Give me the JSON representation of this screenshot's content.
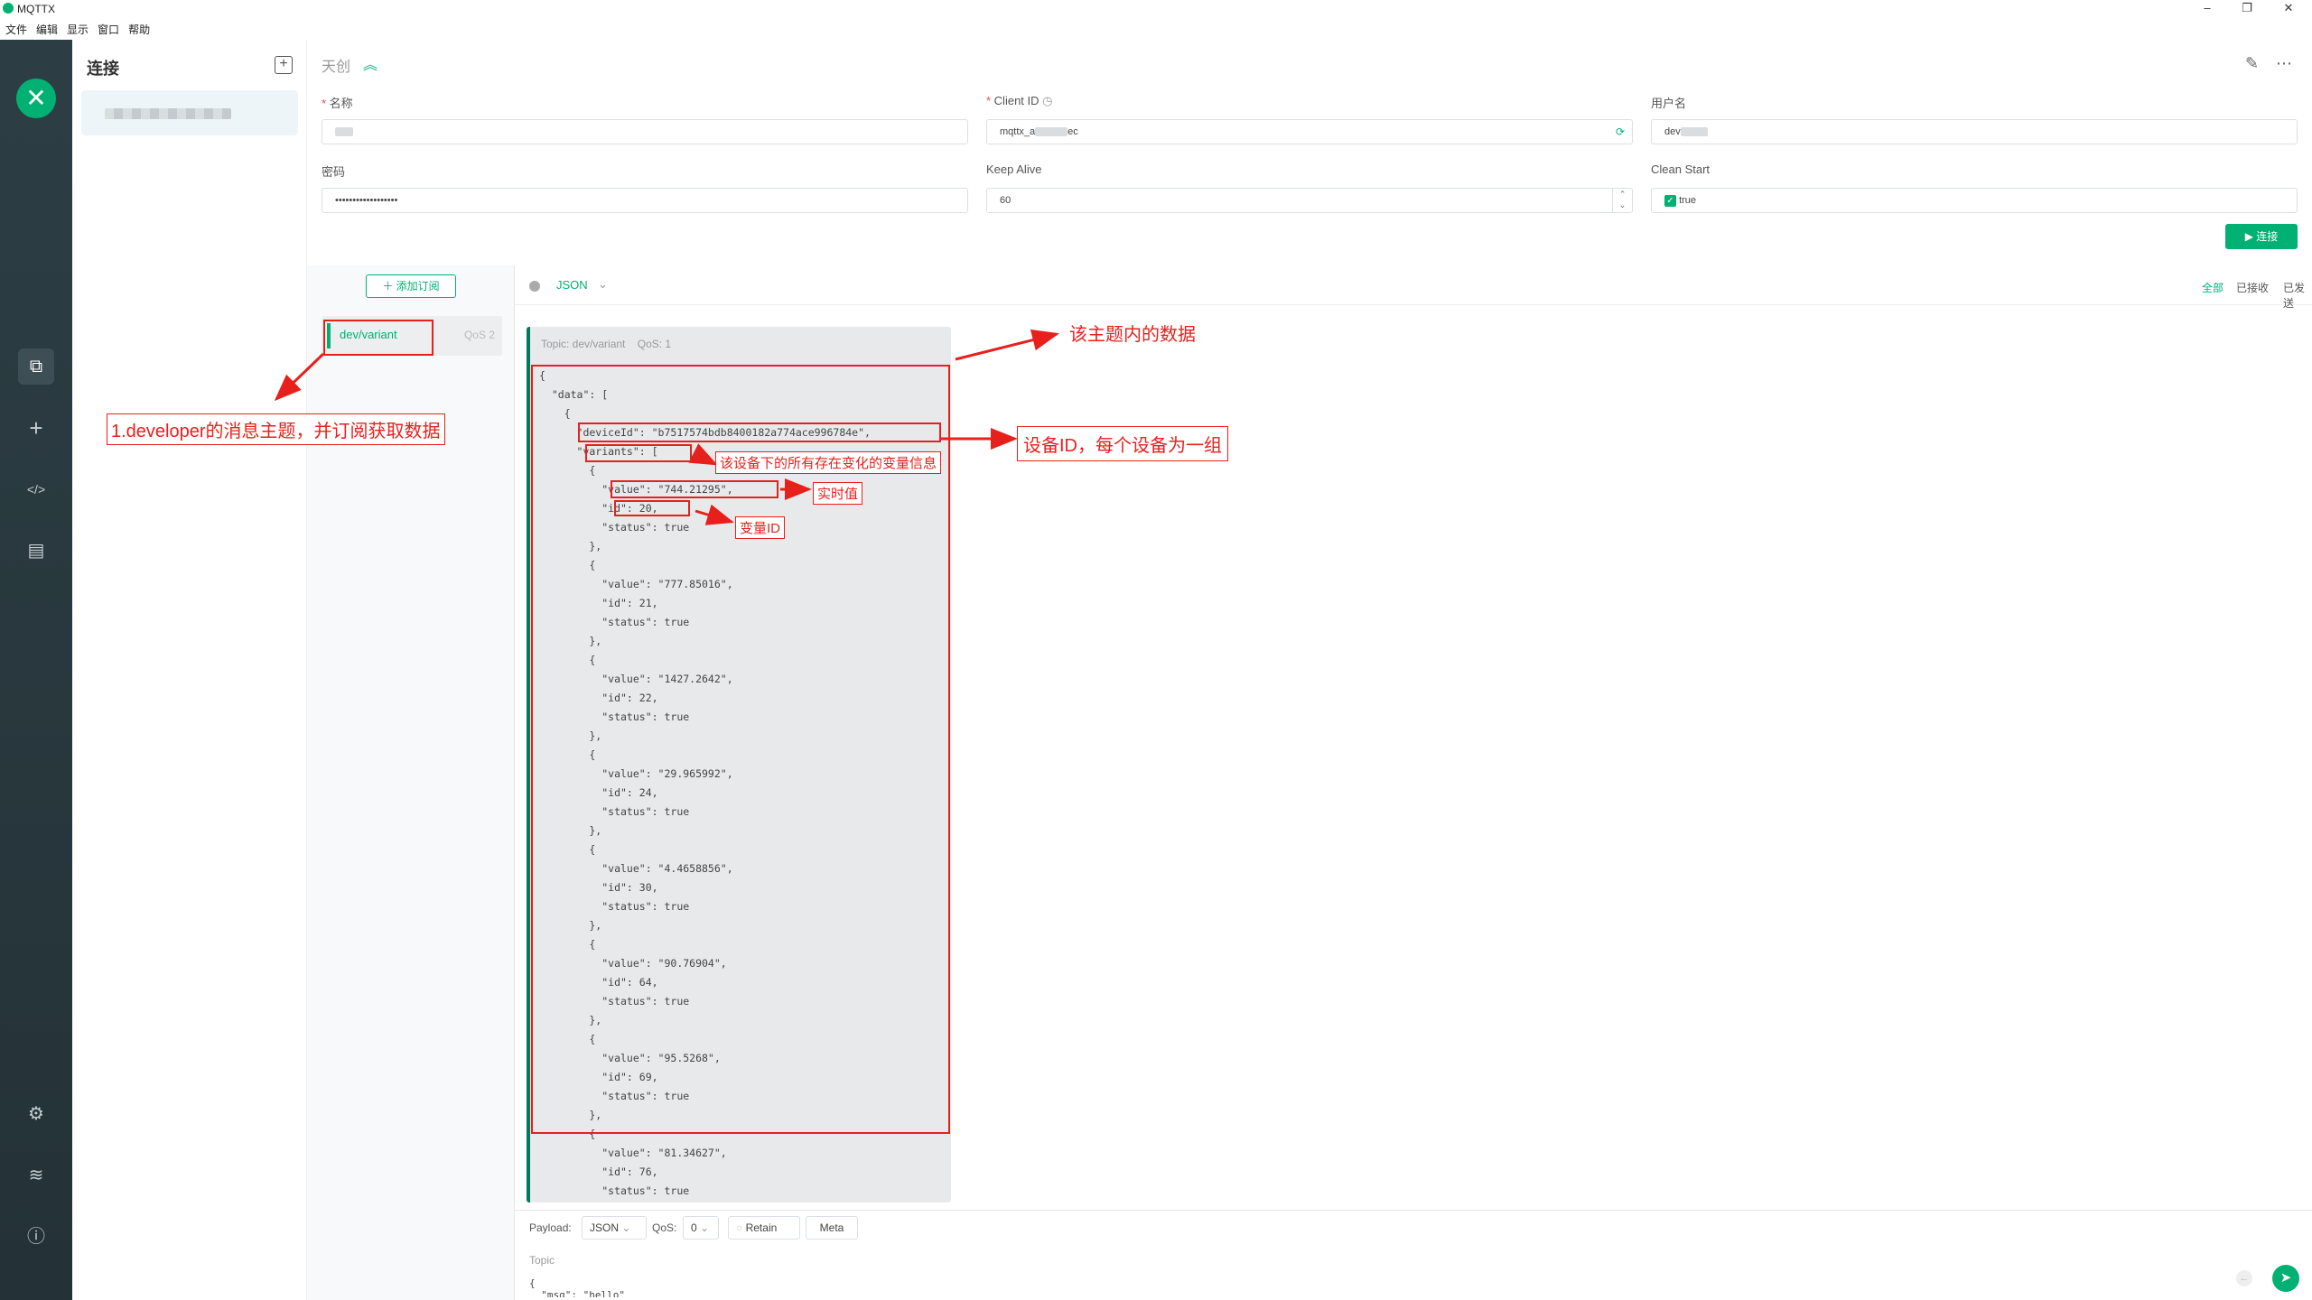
{
  "window": {
    "title": "MQTTX",
    "minimize": "–",
    "restore": "❐",
    "close": "✕"
  },
  "menu": [
    "文件",
    "编辑",
    "显示",
    "窗口",
    "帮助"
  ],
  "sidebar": {
    "brand": "✕",
    "nav": [
      {
        "name": "connections",
        "glyph": "⧉"
      },
      {
        "name": "new",
        "glyph": "+"
      },
      {
        "name": "script",
        "glyph": "</>"
      },
      {
        "name": "log",
        "glyph": "▤"
      },
      {
        "name": "settings",
        "glyph": "⚙"
      },
      {
        "name": "feed",
        "glyph": "≋"
      },
      {
        "name": "about",
        "glyph": "ⓘ"
      }
    ]
  },
  "connections": {
    "header": "连接",
    "add": "+"
  },
  "conn": {
    "name": "天创",
    "fields": {
      "name_label": "名称",
      "name_value": "",
      "client_id_label": "Client ID",
      "client_id_value": "mqttx_a",
      "client_id_suffix": "ec",
      "username_label": "用户名",
      "username_value": "dev",
      "password_label": "密码",
      "password_value": "••••••••••••••••••",
      "keepalive_label": "Keep Alive",
      "keepalive_value": "60",
      "cleanstart_label": "Clean Start",
      "cleanstart_value": "true"
    },
    "connect_btn": "▶ 连接"
  },
  "subscriptions": {
    "add_btn": "＋ 添加订阅",
    "items": [
      {
        "topic": "dev/variant",
        "qos": "QoS 2",
        "color": "#00b173"
      }
    ]
  },
  "messages": {
    "format": "JSON",
    "filters": [
      "全部",
      "已接收",
      "已发送"
    ],
    "topic_meta": "Topic: dev/variant",
    "qos_meta": "QoS: 1",
    "body": "{\n  \"data\": [\n    {\n      \"deviceId\": \"b7517574bdb8400182a774ace996784e\",\n      \"variants\": [\n        {\n          \"value\": \"744.21295\",\n          \"id\": 20,\n          \"status\": true\n        },\n        {\n          \"value\": \"777.85016\",\n          \"id\": 21,\n          \"status\": true\n        },\n        {\n          \"value\": \"1427.2642\",\n          \"id\": 22,\n          \"status\": true\n        },\n        {\n          \"value\": \"29.965992\",\n          \"id\": 24,\n          \"status\": true\n        },\n        {\n          \"value\": \"4.4658856\",\n          \"id\": 30,\n          \"status\": true\n        },\n        {\n          \"value\": \"90.76904\",\n          \"id\": 64,\n          \"status\": true\n        },\n        {\n          \"value\": \"95.5268\",\n          \"id\": 69,\n          \"status\": true\n        },\n        {\n          \"value\": \"81.34627\",\n          \"id\": 76,\n          \"status\": true"
  },
  "composer": {
    "payload_label": "Payload:",
    "payload_value": "JSON",
    "qos_label": "QoS:",
    "qos_value": "0",
    "retain": "Retain",
    "meta": "Meta",
    "topic_placeholder": "Topic",
    "body_preview": "{\n  \"msg\": \"hello\""
  },
  "annotations": {
    "a1": "1.developer的消息主题，并订阅获取数据",
    "a2": "该主题内的数据",
    "a3": "设备ID，每个设备为一组",
    "a4": "该设备下的所有存在变化的变量信息",
    "a5": "实时值",
    "a6": "变量ID"
  },
  "colors": {
    "accent": "#00b173",
    "annotation": "#e8201c",
    "sidebar": "#2c3e44"
  }
}
